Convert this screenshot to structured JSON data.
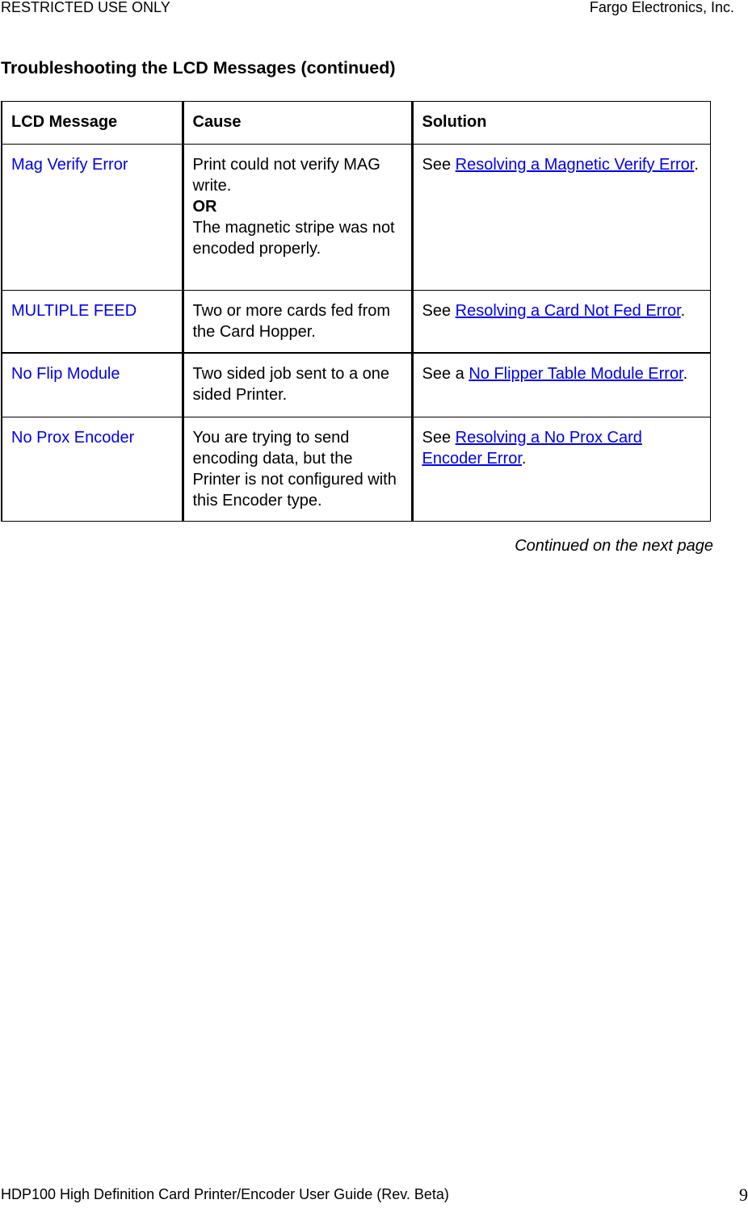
{
  "header": {
    "left": "RESTRICTED USE ONLY",
    "right": "Fargo Electronics, Inc."
  },
  "title": "Troubleshooting the LCD Messages (continued)",
  "table": {
    "columns": [
      "LCD Message",
      "Cause",
      "Solution"
    ],
    "rows": [
      {
        "message": "Mag Verify Error",
        "cause": [
          "Print could not verify MAG write.",
          "OR",
          "The magnetic stripe was not encoded properly."
        ],
        "solution_prefix": "See ",
        "solution_link": "Resolving a Magnetic Verify Error",
        "solution_suffix": "."
      },
      {
        "message": "MULTIPLE FEED",
        "cause": [
          "Two or more cards fed from the Card Hopper."
        ],
        "solution_prefix": "See ",
        "solution_link": "Resolving a Card Not Fed Error",
        "solution_suffix": "."
      },
      {
        "message": "No Flip Module",
        "cause": [
          "Two sided job sent to a one sided Printer."
        ],
        "solution_prefix": "See a ",
        "solution_link": "No Flipper Table Module Error",
        "solution_suffix": "."
      },
      {
        "message": "No Prox Encoder",
        "cause": [
          "You are trying to send encoding data, but the Printer is not configured with this Encoder type."
        ],
        "solution_prefix": "See ",
        "solution_link": "Resolving a No Prox Card Encoder Error",
        "solution_suffix": "."
      }
    ]
  },
  "continued": "Continued on the next page",
  "footer": {
    "left": "HDP100 High Definition Card Printer/Encoder User Guide (Rev. Beta)",
    "page_number": "9"
  },
  "colors": {
    "link": "#0000ee",
    "text": "#000000"
  }
}
